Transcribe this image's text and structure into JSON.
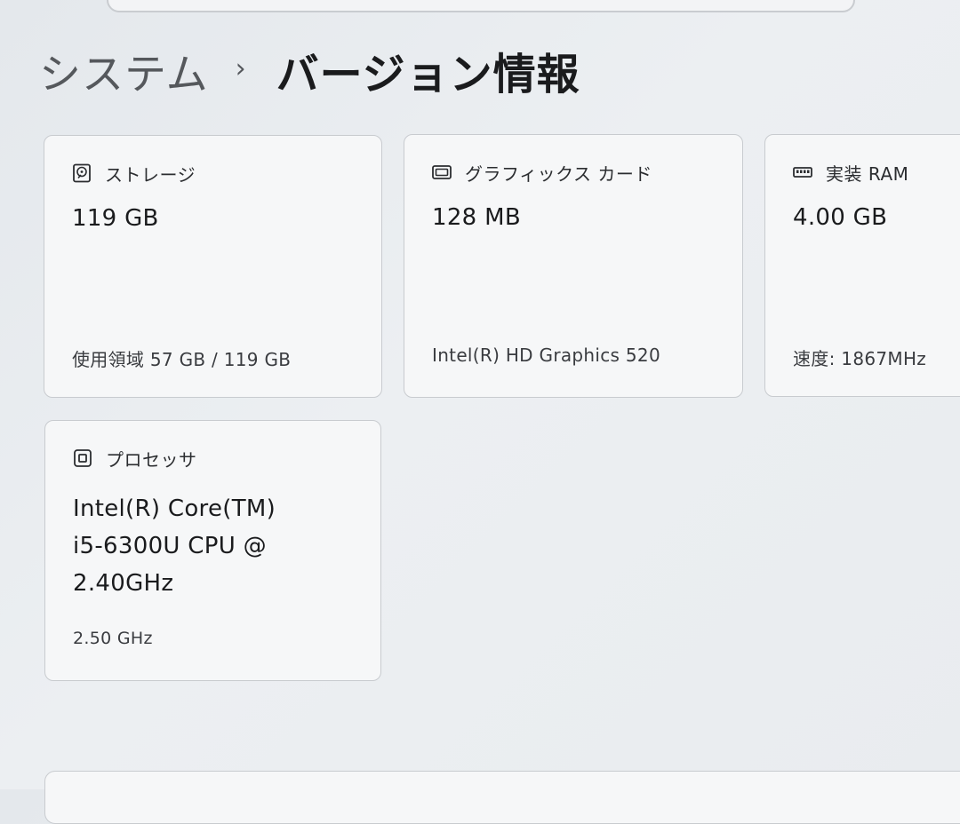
{
  "breadcrumb": {
    "parent": "システム",
    "separator": "›",
    "current": "バージョン情報"
  },
  "cards": {
    "storage": {
      "icon": "hard-drive-icon",
      "label": "ストレージ",
      "value": "119 GB",
      "detail": "使用領域 57 GB / 119 GB"
    },
    "gpu": {
      "icon": "graphics-card-icon",
      "label": "グラフィックス カード",
      "value": "128 MB",
      "detail": "Intel(R) HD Graphics 520"
    },
    "ram": {
      "icon": "memory-icon",
      "label": "実装 RAM",
      "value": "4.00 GB",
      "detail": "速度: 1867MHz"
    },
    "cpu": {
      "icon": "processor-icon",
      "label": "プロセッサ",
      "value": "Intel(R) Core(TM)\ni5-6300U CPU @\n2.40GHz",
      "detail": "2.50 GHz"
    }
  }
}
